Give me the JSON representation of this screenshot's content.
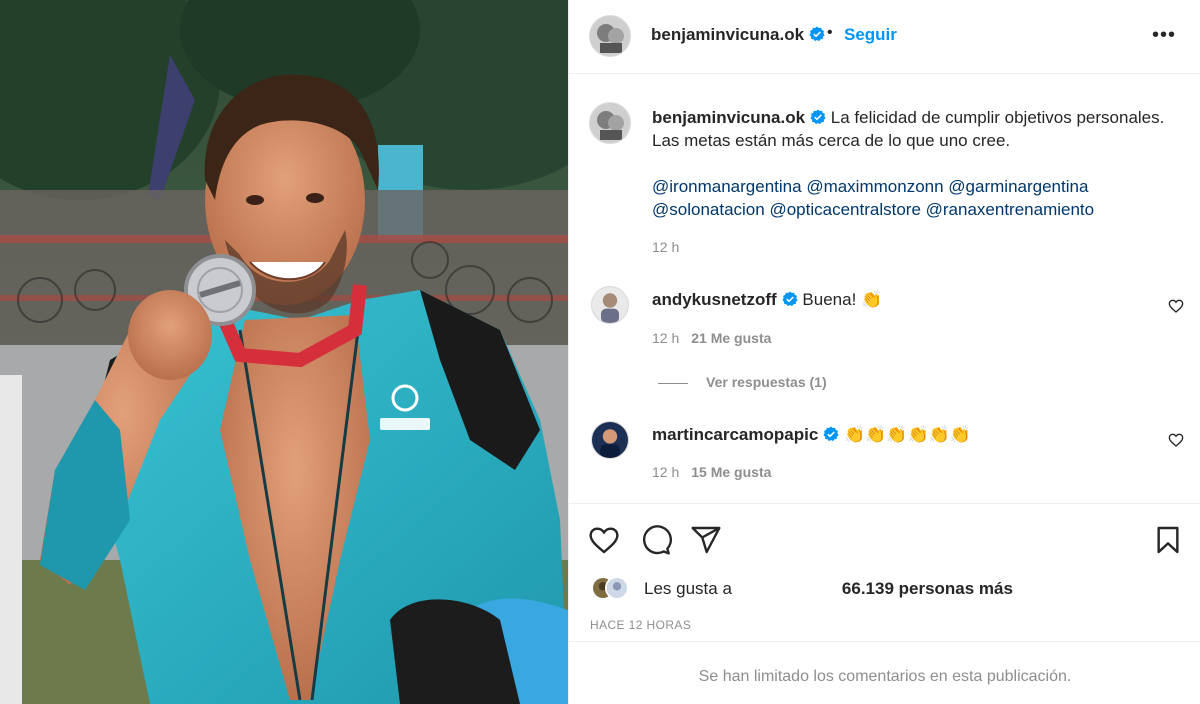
{
  "post": {
    "photo_alt": "",
    "header": {
      "username": "benjaminvicuna.ok",
      "separator": "•",
      "follow_label": "Seguir",
      "more_icon": "more-horizontal-icon"
    },
    "caption": {
      "username": "benjaminvicuna.ok",
      "text": "La felicidad de cumplir objetivos personales. Las metas están más cerca de lo que uno cree.",
      "mentions": [
        "@ironmanargentina",
        "@maximmonzonn",
        "@garminargentina",
        "@solonatacion",
        "@opticacentralstore",
        "@ranaxentrenamiento"
      ],
      "time": "12 h"
    },
    "comments": [
      {
        "username": "andykusnetzoff",
        "text": "Buena! 👏",
        "time": "12 h",
        "likes": "21 Me gusta",
        "replies": "Ver respuestas (1)"
      },
      {
        "username": "martincarcamopapic",
        "text": "👏👏👏👏👏👏",
        "time": "12 h",
        "likes": "15 Me gusta"
      }
    ],
    "actions": {
      "like_icon": "heart-icon",
      "comment_icon": "comment-icon",
      "share_icon": "send-icon",
      "save_icon": "bookmark-icon"
    },
    "likes": {
      "prefix": "Les gusta a",
      "count": "66.139 personas más"
    },
    "posted": "HACE 12 HORAS",
    "limited_comments": "Se han limitado los comentarios en esta publicación."
  },
  "colors": {
    "link": "#0095f6",
    "mention": "#00376b",
    "secondary_text": "#8e8e8e",
    "verified": "#0095f6",
    "jersey": "#2ab4c8"
  }
}
